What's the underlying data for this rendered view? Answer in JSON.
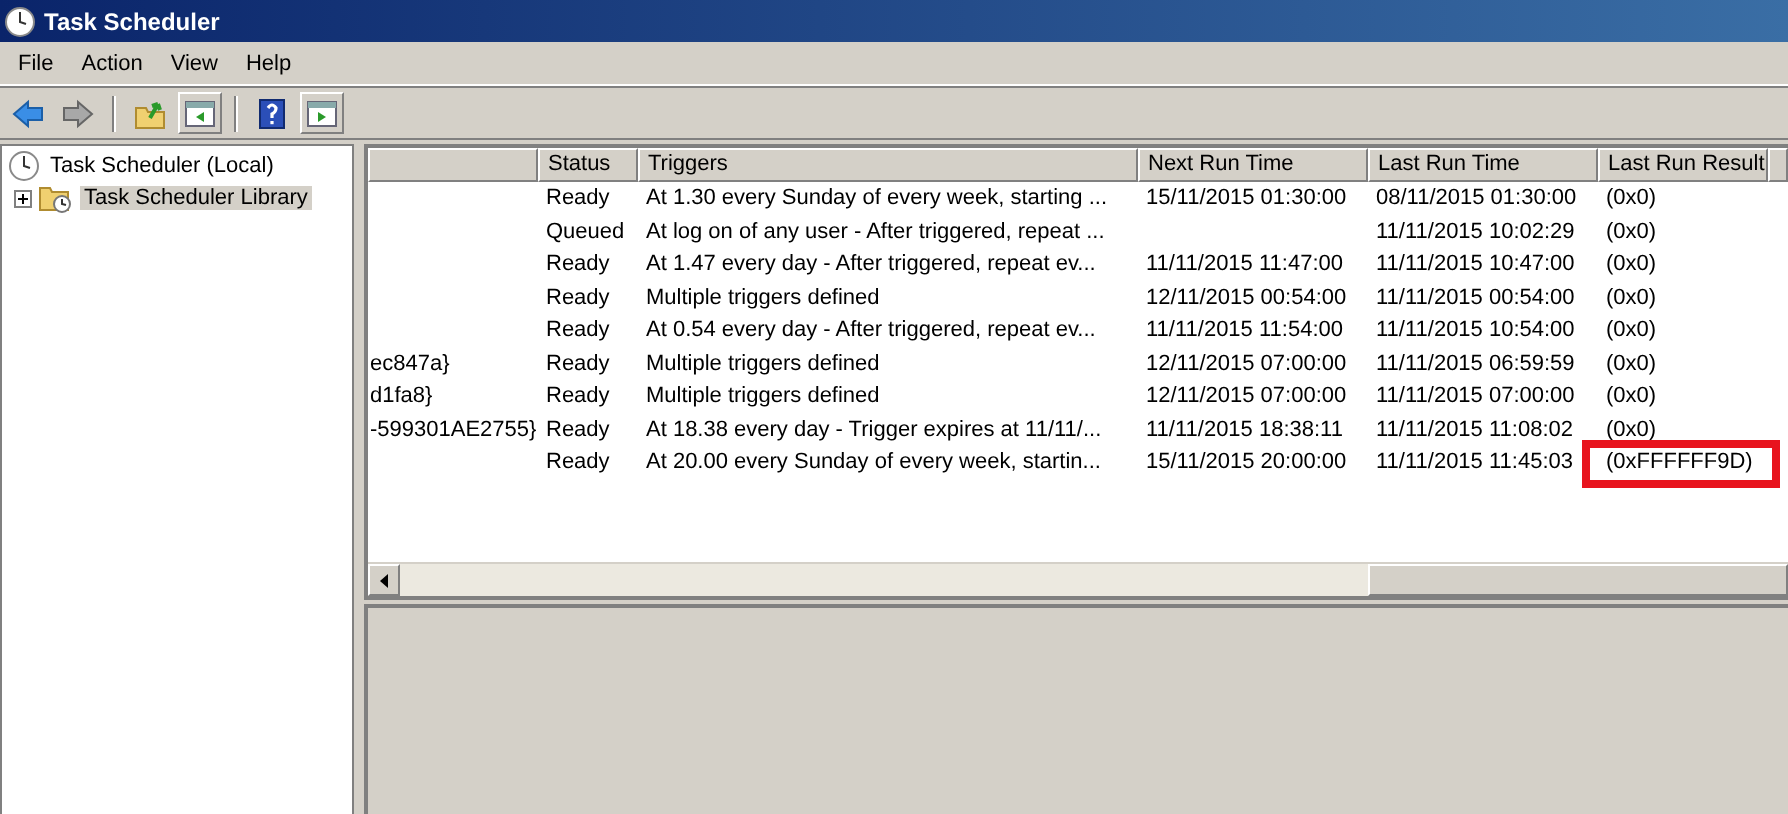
{
  "window": {
    "title": "Task Scheduler"
  },
  "menu": [
    "File",
    "Action",
    "View",
    "Help"
  ],
  "toolbar": [
    {
      "kind": "back",
      "disabled": false
    },
    {
      "kind": "forward",
      "disabled": true
    },
    {
      "kind": "folder-up",
      "disabled": false
    },
    {
      "kind": "pane-left",
      "disabled": false
    },
    {
      "kind": "help",
      "disabled": false
    },
    {
      "kind": "pane-right",
      "disabled": false
    }
  ],
  "tree": [
    {
      "label": "Task Scheduler (Local)",
      "selected": false,
      "children": [
        {
          "label": "Task Scheduler Library",
          "selected": true,
          "expanded": false
        }
      ]
    }
  ],
  "table": {
    "columns": [
      "Status",
      "Triggers",
      "Next Run Time",
      "Last Run Time",
      "Last Run Result"
    ],
    "rows": [
      {
        "status": "Ready",
        "triggers": "At 1.30 every Sunday of every week, starting ...",
        "next_run_time": "15/11/2015 01:30:00",
        "last_run_time": "08/11/2015 01:30:00",
        "last_run_result": "(0x0)",
        "highlighted": false
      },
      {
        "status": "Queued",
        "triggers": "At log on of any user - After triggered, repeat ...",
        "last_run_time": "11/11/2015 10:02:29",
        "last_run_result": "(0x0)",
        "highlighted": false
      },
      {
        "status": "Ready",
        "triggers": "At 1.47 every day - After triggered, repeat ev...",
        "next_run_time": "11/11/2015 11:47:00",
        "last_run_time": "11/11/2015 10:47:00",
        "last_run_result": "(0x0)",
        "highlighted": false
      },
      {
        "status": "Ready",
        "triggers": "Multiple triggers defined",
        "next_run_time": "12/11/2015 00:54:00",
        "last_run_time": "11/11/2015 00:54:00",
        "last_run_result": "(0x0)",
        "highlighted": false
      },
      {
        "status": "Ready",
        "triggers": "At 0.54 every day - After triggered, repeat ev...",
        "next_run_time": "11/11/2015 11:54:00",
        "last_run_time": "11/11/2015 10:54:00",
        "last_run_result": "(0x0)",
        "highlighted": false
      },
      {
        "column_1": "ec847a}",
        "status": "Ready",
        "triggers": "Multiple triggers defined",
        "next_run_time": "12/11/2015 07:00:00",
        "last_run_time": "11/11/2015 06:59:59",
        "last_run_result": "(0x0)",
        "highlighted": false
      },
      {
        "column_1": "d1fa8}",
        "status": "Ready",
        "triggers": "Multiple triggers defined",
        "next_run_time": "12/11/2015 07:00:00",
        "last_run_time": "11/11/2015 07:00:00",
        "last_run_result": "(0x0)",
        "highlighted": false
      },
      {
        "column_1": "-599301AE2755}",
        "status": "Ready",
        "triggers": "At 18.38 every day - Trigger expires at 11/11/...",
        "next_run_time": "11/11/2015 18:38:11",
        "last_run_time": "11/11/2015 11:08:02",
        "last_run_result": "(0x0)",
        "highlighted": false
      },
      {
        "status": "Ready",
        "triggers": "At 20.00 every Sunday of every week, startin...",
        "next_run_time": "15/11/2015 20:00:00",
        "last_run_time": "11/11/2015 11:45:03",
        "last_run_result": "(0xFFFFFF9D)",
        "highlighted": true
      }
    ]
  }
}
